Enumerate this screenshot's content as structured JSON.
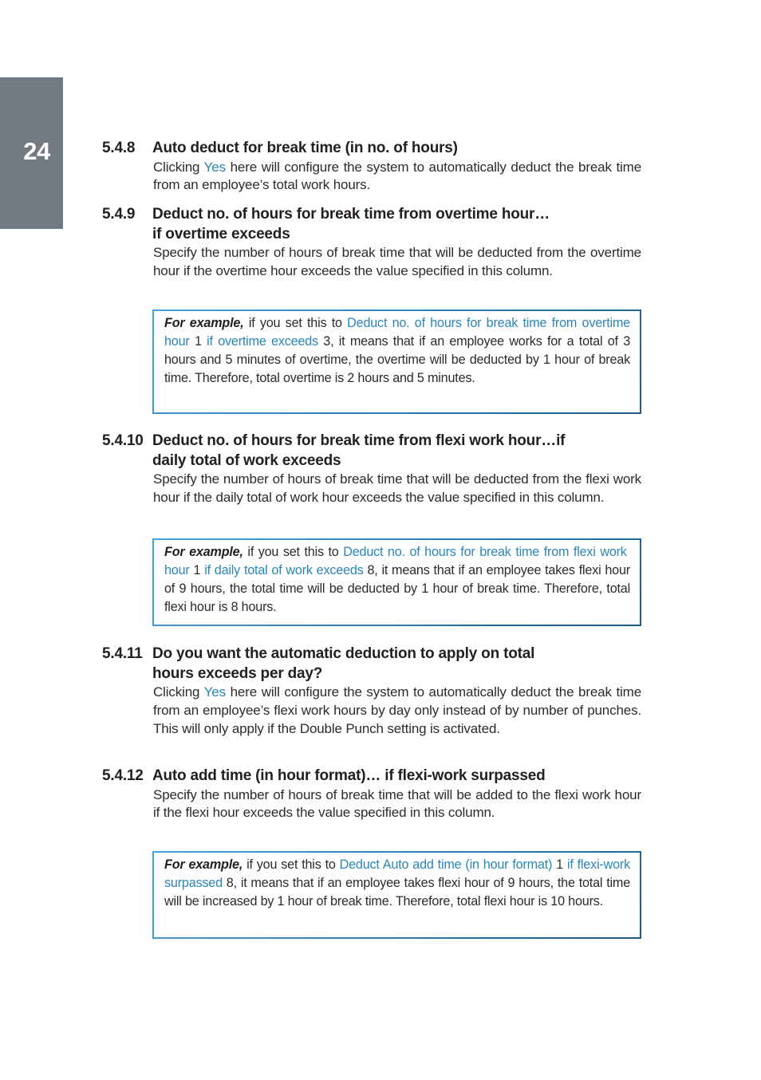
{
  "page": {
    "number": "24"
  },
  "colors": {
    "tab": "#737b82",
    "highlight": "#2a86b8",
    "box_border_light": "#45a3d8",
    "box_border_dark": "#1d5b86"
  },
  "sections": [
    {
      "number": "5.4.8",
      "title": "Auto deduct for break time (in no. of hours)",
      "body": {
        "pre": "Clicking ",
        "hl": "Yes",
        "post": " here will configure the system to automatically deduct the break time from an employee’s total work hours."
      }
    },
    {
      "number": "5.4.9",
      "title_line1": "Deduct no. of hours for break time from overtime hour…",
      "title_line2": "if overtime exceeds",
      "body": "Specify the number of hours of break time that will be deducted from the overtime hour if the overtime hour exceeds the value specified in this column.",
      "example": {
        "lead": "For example,",
        "t1": " if you set this to ",
        "h1": "Deduct no. of hours for break time from overtime hour",
        "t2": " 1 ",
        "h2": "if overtime exceeds",
        "t3": " 3, it means that if an employee works for a total of 3 hours and 5 minutes of overtime, the overtime will be deducted by 1 hour of break time. Therefore, total overtime is 2 hours and 5 minutes."
      }
    },
    {
      "number": "5.4.10",
      "title_line1": "Deduct no. of hours for break time from flexi work hour…if",
      "title_line2": "daily total of work exceeds",
      "body": "Specify the number of hours of break time that will be deducted from the flexi work hour if the daily total of work hour exceeds the value specified in this column.",
      "example": {
        "lead": "For example,",
        "t1": " if you set this to ",
        "h1": "Deduct no. of hours for break time from flexi work  hour",
        "t2": " 1 ",
        "h2": "if daily total of work exceeds",
        "t3": " 8, it means that if an em­ployee takes flexi hour of 9 hours, the total time will be deducted by 1 hour of break time. Therefore, total flexi hour is 8 hours."
      }
    },
    {
      "number": "5.4.11",
      "title_line1": "Do you want the automatic deduction to apply on total",
      "title_line2": "hours exceeds per day?",
      "body": {
        "pre": "Clicking ",
        "hl": "Yes",
        "post": " here will configure the system to automatically deduct the break time from an employee’s flexi work hours by day only in­stead of by number of punches. This will only apply if the Double Punch setting is activated."
      }
    },
    {
      "number": "5.4.12",
      "title": "Auto add time (in hour format)… if flexi-work surpassed",
      "body": "Specify the number of hours of break time that will be added to the flexi work hour if the flexi hour exceeds the value specified in this col­umn.",
      "example": {
        "lead": "For example,",
        "t1": " if you set this to ",
        "h1": "Deduct Auto add time (in hour format)",
        "t2": " 1 ",
        "h2": "if flexi-work surpassed",
        "t3": " 8, it means that if an employee takes flexi hour of 9 hours, the total time will be increased by 1 hour of break time. Therefore, total flexi hour is 10 hours."
      }
    }
  ]
}
